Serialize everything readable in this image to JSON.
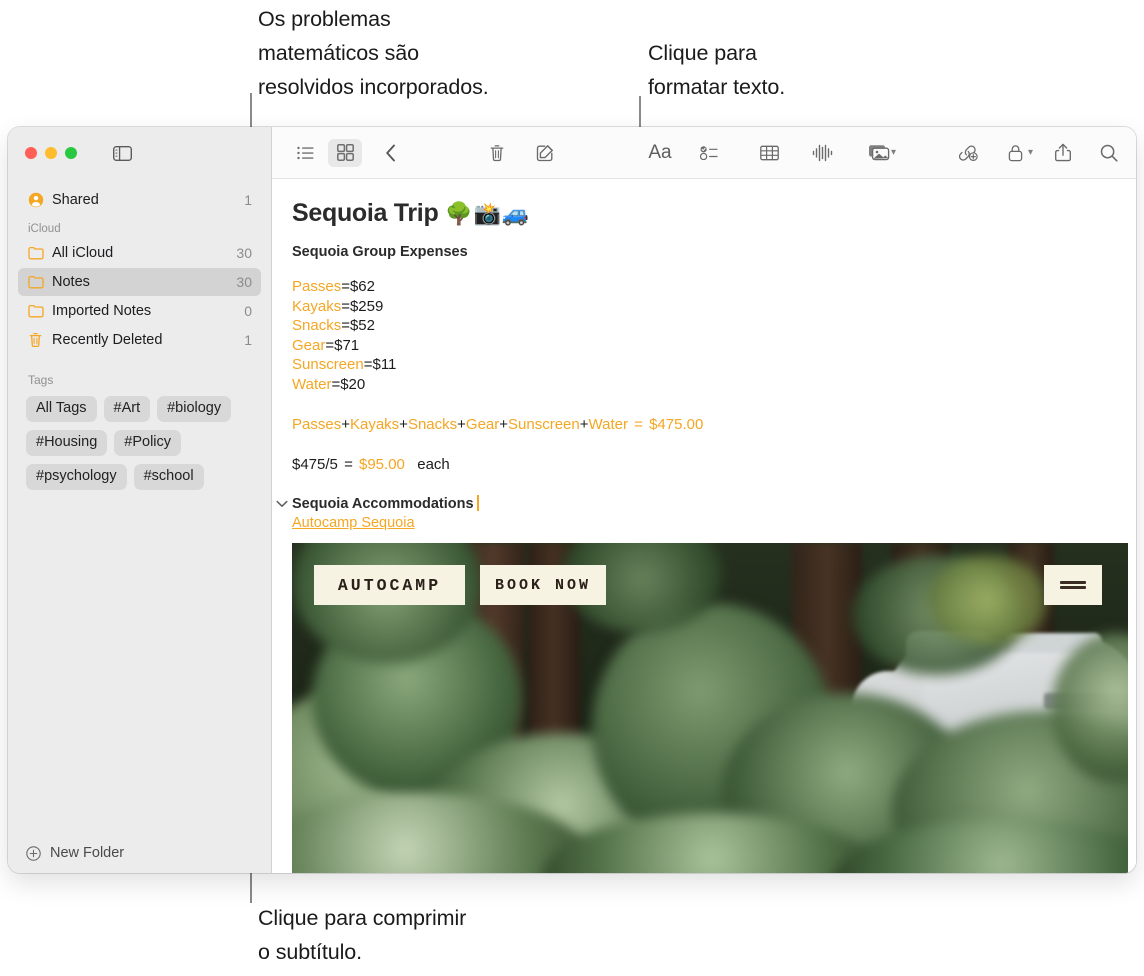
{
  "callouts": [
    {
      "id": "math",
      "text": "Os problemas\nmatemáticos são\nresolvidos incorporados."
    },
    {
      "id": "format",
      "text": "Clique para\nformatar texto."
    },
    {
      "id": "collapse",
      "text": "Clique para comprimir\no subtítulo."
    }
  ],
  "window": {
    "traffic_lights": [
      "close",
      "minimize",
      "zoom"
    ],
    "sidebar_toggle_icon": "sidebar-toggle-icon"
  },
  "sidebar": {
    "shared": {
      "label": "Shared",
      "count": "1",
      "icon": "shared-person-icon"
    },
    "icloud_section": "iCloud",
    "folders": [
      {
        "label": "All iCloud",
        "count": "30",
        "icon": "folder-icon",
        "selected": false
      },
      {
        "label": "Notes",
        "count": "30",
        "icon": "folder-icon",
        "selected": true
      },
      {
        "label": "Imported Notes",
        "count": "0",
        "icon": "folder-icon",
        "selected": false
      },
      {
        "label": "Recently Deleted",
        "count": "1",
        "icon": "trash-icon",
        "selected": false
      }
    ],
    "tags_section": "Tags",
    "tags": [
      "All Tags",
      "#Art",
      "#biology",
      "#Housing",
      "#Policy",
      "#psychology",
      "#school"
    ],
    "new_folder": {
      "label": "New Folder",
      "icon": "plus-circle-icon"
    }
  },
  "toolbar": {
    "items": [
      {
        "name": "list-view-icon",
        "label": "List View"
      },
      {
        "name": "gallery-view-icon",
        "label": "Gallery View"
      },
      {
        "name": "back-chevron-icon",
        "label": "Back"
      },
      {
        "name": "delete-trash-icon",
        "label": "Delete"
      },
      {
        "name": "compose-note-icon",
        "label": "New Note"
      },
      {
        "name": "format-text-icon",
        "label": "Aa"
      },
      {
        "name": "checklist-icon",
        "label": "Checklist"
      },
      {
        "name": "table-icon",
        "label": "Table"
      },
      {
        "name": "audio-waveform-icon",
        "label": "Record Audio"
      },
      {
        "name": "media-photo-icon",
        "label": "Media"
      },
      {
        "name": "link-add-icon",
        "label": "Add Link"
      },
      {
        "name": "lock-icon",
        "label": "Lock Note"
      },
      {
        "name": "share-icon",
        "label": "Share"
      },
      {
        "name": "search-icon",
        "label": "Search"
      }
    ],
    "format_label": "Aa"
  },
  "note": {
    "title": "Sequoia Trip",
    "title_emoji": "🌳📸🚙",
    "subtitle": "Sequoia Group Expenses",
    "expenses": [
      {
        "name": "Passes",
        "value": "=$62"
      },
      {
        "name": "Kayaks",
        "value": "=$259"
      },
      {
        "name": "Snacks",
        "value": "=$52"
      },
      {
        "name": "Gear",
        "value": "=$71"
      },
      {
        "name": "Sunscreen",
        "value": "=$11"
      },
      {
        "name": "Water",
        "value": "=$20"
      }
    ],
    "sum_terms": [
      "Passes",
      "Kayaks",
      "Snacks",
      "Gear",
      "Sunscreen",
      "Water"
    ],
    "sum_operator": "+",
    "sum_equals": "=",
    "sum_result": "$475.00",
    "each_expression": "$475/5",
    "each_equals": "=",
    "each_result": "$95.00",
    "each_suffix": "each",
    "accommodations_heading": "Sequoia Accommodations",
    "accommodations_link": "Autocamp Sequoia",
    "collapse_chevron": "chevron-down-icon"
  },
  "photo": {
    "alt": "autocamp-sequoia-website-screenshot",
    "logo": "AUTOCAMP",
    "book_now": "BOOK NOW",
    "menu_icon": "hamburger-menu-icon"
  },
  "colors": {
    "accent_amber": "#f5a623",
    "sidebar_bg": "#ececec",
    "selected_row": "#d3d3d3",
    "tag_bg": "#d8d8d8"
  }
}
